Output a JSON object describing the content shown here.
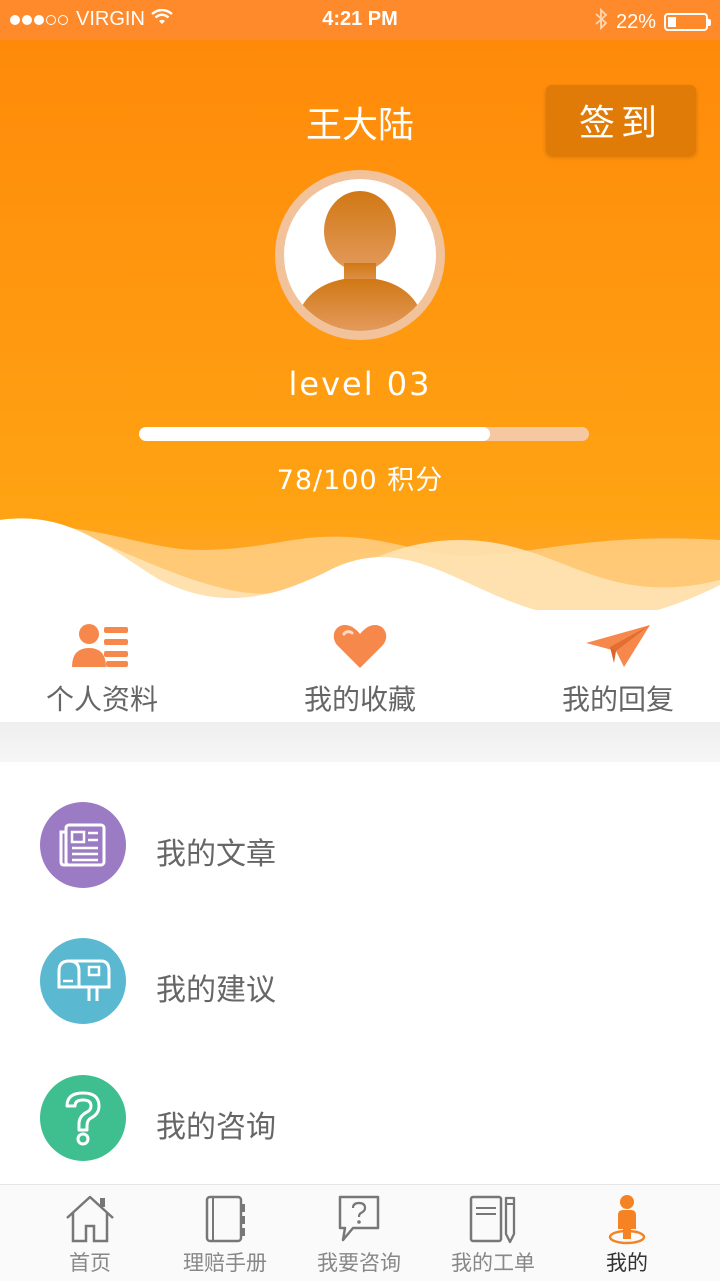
{
  "status_bar": {
    "carrier": "VIRGIN",
    "time": "4:21 PM",
    "battery": "22%",
    "signal_dots_full": 3,
    "signal_dots_total": 5,
    "icons": [
      "wifi-icon",
      "bluetooth-icon",
      "battery-icon"
    ]
  },
  "profile": {
    "name": "王大陆",
    "checkin_label": "签到",
    "level": "level 03",
    "points_text": "78/100 积分",
    "progress": 0.78
  },
  "quick_actions": [
    {
      "label": "个人资料",
      "icon": "profile-list-icon"
    },
    {
      "label": "我的收藏",
      "icon": "heart-icon"
    },
    {
      "label": "我的回复",
      "icon": "paper-plane-icon"
    }
  ],
  "menu": [
    {
      "label": "我的文章",
      "icon": "newspaper-icon",
      "color": "#9b7cc4"
    },
    {
      "label": "我的建议",
      "icon": "mailbox-icon",
      "color": "#5ab8d0"
    },
    {
      "label": "我的咨询",
      "icon": "question-icon",
      "color": "#3fbf8f"
    }
  ],
  "tabs": [
    {
      "label": "首页",
      "icon": "home-icon"
    },
    {
      "label": "理赔手册",
      "icon": "handbook-icon"
    },
    {
      "label": "我要咨询",
      "icon": "consult-icon"
    },
    {
      "label": "我的工单",
      "icon": "work-order-icon"
    },
    {
      "label": "我的",
      "icon": "person-icon",
      "active": true
    }
  ],
  "colors": {
    "accent": "#ff8a0a",
    "checkin_button": "#e07b07",
    "quick_icon": "#f7884b"
  }
}
